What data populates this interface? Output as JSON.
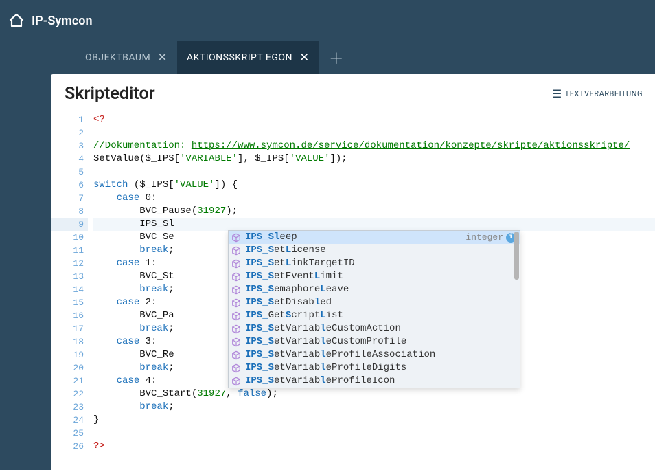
{
  "app": {
    "title": "IP-Symcon"
  },
  "tabs": [
    {
      "label": "OBJEKTBAUM",
      "active": false
    },
    {
      "label": "AKTIONSSKRIPT EGON",
      "active": true
    }
  ],
  "panel": {
    "title": "Skripteditor",
    "tool_label": "TEXTVERARBEITUNG"
  },
  "code": {
    "line_count": 26,
    "current_line": 9,
    "lines": {
      "l1": "<?",
      "l2": "",
      "l3_a": "//Dokumentation: ",
      "l3_b": "https://www.symcon.de/service/dokumentation/konzepte/skripte/aktionsskripte/",
      "l4_a": "SetValue($_IPS[",
      "l4_b": "'VARIABLE'",
      "l4_c": "], $_IPS[",
      "l4_d": "'VALUE'",
      "l4_e": "]);",
      "l5": "",
      "l6_a": "switch",
      "l6_b": " ($_IPS[",
      "l6_c": "'VALUE'",
      "l6_d": "]) {",
      "l7_a": "case",
      "l7_b": " 0:",
      "l8_a": "BVC_Pause(",
      "l8_b": "31927",
      "l8_c": ");",
      "l9": "IPS_Sl",
      "l10": "BVC_Se",
      "l11_a": "break",
      "l11_b": ";",
      "l12_a": "case",
      "l12_b": " 1:",
      "l13": "BVC_St",
      "l14_a": "break",
      "l14_b": ";",
      "l15_a": "case",
      "l15_b": " 2:",
      "l16": "BVC_Pa",
      "l17_a": "break",
      "l17_b": ";",
      "l18_a": "case",
      "l18_b": " 3:",
      "l19": "BVC_Re",
      "l20_a": "break",
      "l20_b": ";",
      "l21_a": "case",
      "l21_b": " 4:",
      "l22_a": "BVC_Start(",
      "l22_b": "31927",
      "l22_c": ", ",
      "l22_d": "false",
      "l22_e": ");",
      "l23_a": "break",
      "l23_b": ";",
      "l24": "}",
      "l25": "",
      "l26": "?>"
    }
  },
  "autocomplete": {
    "type_hint": "integer",
    "items": [
      {
        "pre": "IPS_Sl",
        "post": "eep",
        "selected": true
      },
      {
        "pre": "IPS_S",
        "mid1": "et",
        "m2": "L",
        "post": "icense"
      },
      {
        "pre": "IPS_S",
        "mid1": "et",
        "m2": "L",
        "post": "inkTargetID"
      },
      {
        "pre": "IPS_S",
        "mid1": "etEvent",
        "m2": "L",
        "post": "imit"
      },
      {
        "pre": "IPS_S",
        "mid1": "emaphore",
        "m2": "L",
        "post": "eave"
      },
      {
        "pre": "IPS_S",
        "mid1": "etDisab",
        "m2": "l",
        "post": "ed"
      },
      {
        "pre": "IPS_",
        "mid1": "Get",
        "m2": "S",
        "mid2": "cript",
        "m3": "L",
        "post": "ist"
      },
      {
        "pre": "IPS_S",
        "mid1": "etVariab",
        "m2": "l",
        "post": "eCustomAction"
      },
      {
        "pre": "IPS_S",
        "mid1": "etVariab",
        "m2": "l",
        "post": "eCustomProfile"
      },
      {
        "pre": "IPS_S",
        "mid1": "etVariab",
        "m2": "l",
        "post": "eProfileAssociation"
      },
      {
        "pre": "IPS_S",
        "mid1": "etVariab",
        "m2": "l",
        "post": "eProfileDigits"
      },
      {
        "pre": "IPS_S",
        "mid1": "etVariab",
        "m2": "l",
        "post": "eProfileIcon"
      }
    ]
  }
}
